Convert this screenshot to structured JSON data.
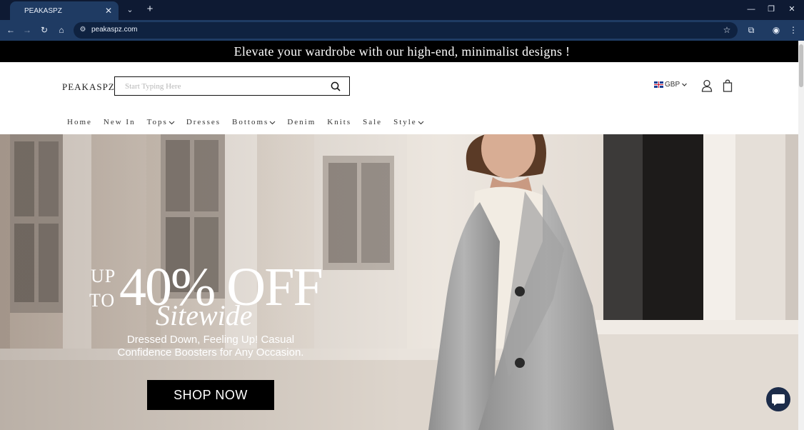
{
  "browser": {
    "tab_title": "PEAKASPZ",
    "url": "peakaspz.com"
  },
  "announcement": "Elevate your wardrobe with our high-end, minimalist designs !",
  "header": {
    "logo": "PEAKASPZ",
    "search_placeholder": "Start Typing Here",
    "currency": "GBP"
  },
  "nav": {
    "items": [
      {
        "label": "Home"
      },
      {
        "label": "New In"
      },
      {
        "label": "Tops"
      },
      {
        "label": "Dresses"
      },
      {
        "label": "Bottoms"
      },
      {
        "label": "Denim"
      },
      {
        "label": "Knits"
      },
      {
        "label": "Sale"
      },
      {
        "label": "Style"
      }
    ]
  },
  "hero": {
    "promo_up": "UP",
    "promo_to": "TO",
    "promo_big": "40% OFF",
    "promo_script": "Sitewide",
    "subtitle": "Dressed Down, Feeling Up! Casual Confidence Boosters for Any Occasion.",
    "cta": "SHOP NOW"
  },
  "colors": {
    "chrome_dark": "#0e1a33",
    "chrome_tab": "#1f3b63",
    "announcement_bg": "#000000",
    "cta_bg": "#000000",
    "chat_bg": "#1c2c4a"
  }
}
